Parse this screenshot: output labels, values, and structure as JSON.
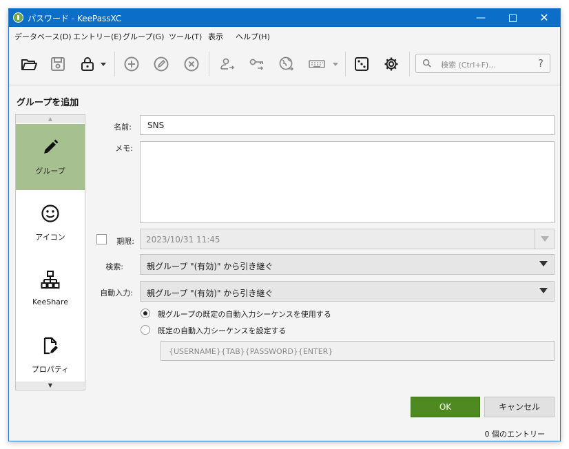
{
  "window": {
    "title": "パスワード - KeePassXC"
  },
  "menu": [
    "データベース(D)",
    "エントリー(E)",
    "グループ(G)",
    "ツール(T)",
    "表示",
    "ヘルプ(H)"
  ],
  "toolbar": {
    "icons": [
      "folder-open-icon",
      "save-icon",
      "lock-icon",
      "dropdown-arrow-icon",
      "add-entry-icon",
      "edit-entry-icon",
      "delete-entry-icon",
      "copy-username-icon",
      "copy-password-icon",
      "open-url-icon",
      "autotype-keyboard-icon",
      "password-generator-dice-icon",
      "settings-gear-icon"
    ],
    "search_placeholder": "検索 (Ctrl+F)...",
    "search_help": "?"
  },
  "page": {
    "title": "グループを追加"
  },
  "sidebar": {
    "items": [
      {
        "label": "グループ",
        "icon": "pencil-icon",
        "active": true
      },
      {
        "label": "アイコン",
        "icon": "smiley-icon",
        "active": false
      },
      {
        "label": "KeeShare",
        "icon": "network-icon",
        "active": false
      },
      {
        "label": "プロパティ",
        "icon": "document-edit-icon",
        "active": false
      }
    ],
    "scroll_up": "▲",
    "scroll_down": "▼"
  },
  "form": {
    "name_label": "名前:",
    "name_value": "SNS",
    "notes_label": "メモ:",
    "notes_value": "",
    "expires_label": "期限:",
    "expires_value": "2023/10/31 11:45",
    "search_label": "検索:",
    "search_value": "親グループ \"(有効)\" から引き継ぐ",
    "autotype_label": "自動入力:",
    "autotype_value": "親グループ \"(有効)\" から引き継ぐ",
    "radio_default": "親グループの既定の自動入力シーケンスを使用する",
    "radio_custom": "既定の自動入力シーケンスを設定する",
    "sequence_value": "{USERNAME}{TAB}{PASSWORD}{ENTER}"
  },
  "buttons": {
    "ok": "OK",
    "cancel": "キャンセル"
  },
  "status": {
    "text": "0 個のエントリー"
  },
  "colors": {
    "accent": "#0b6fc9",
    "ok_button": "#4e8a20",
    "sidebar_active": "#a6c08f"
  }
}
